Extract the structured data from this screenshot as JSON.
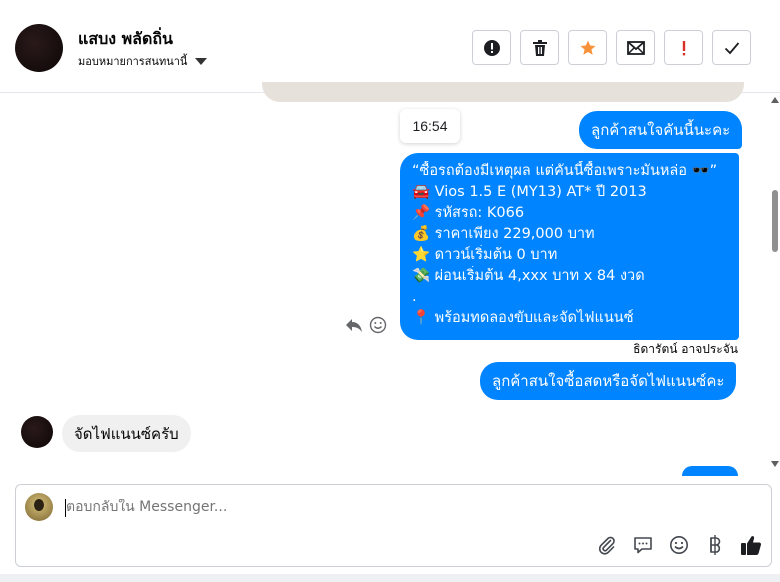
{
  "header": {
    "contact_name": "แสบง พลัดถิ่น",
    "assign_label": "มอบหมายการสนทนานี้",
    "actions": [
      {
        "name": "report-button",
        "icon": "alert-circle-icon"
      },
      {
        "name": "delete-button",
        "icon": "trash-icon"
      },
      {
        "name": "star-button",
        "icon": "star-icon",
        "color": "#f7923b"
      },
      {
        "name": "mark-unread-button",
        "icon": "envelope-icon"
      },
      {
        "name": "follow-up-button",
        "icon": "exclamation-icon",
        "color": "#d93025"
      },
      {
        "name": "mark-done-button",
        "icon": "check-icon"
      }
    ]
  },
  "messages": {
    "time_tooltip": "16:54",
    "outgoing_1": "ลูกค้าสนใจคันนี้นะคะ",
    "listing_lines": [
      "“ซื้อรถต้องมีเหตุผล แต่คันนี้ซื้อเพราะมันหล่อ 🕶️”",
      "🚘 Vios 1.5 E (MY13) AT* ปี 2013",
      "📌 รหัสรถ: K066",
      "💰 ราคาเพียง 229,000 บาท",
      "⭐ ดาวน์เริ่มต้น 0 บาท",
      "💸 ผ่อนเริ่มต้น 4,xxx บาท x 84 งวด",
      ".",
      "📍 พร้อมทดลองขับและจัดไฟแนนซ์"
    ],
    "sender_name": "ธิดารัตน์ อาจประจัน",
    "outgoing_2": "ลูกค้าสนใจซื้อสดหรือจัดไฟแนนซ์คะ",
    "incoming_1": "จัดไฟแนนซ์ครับ"
  },
  "composer": {
    "placeholder": "ตอบกลับใน Messenger...",
    "tools": [
      "paperclip-icon",
      "speech-bubble-icon",
      "emoji-icon",
      "baht-icon",
      "thumbs-up-icon"
    ]
  },
  "colors": {
    "accent_blue": "#0084ff",
    "star_orange": "#f7923b",
    "alert_red": "#d93025"
  }
}
